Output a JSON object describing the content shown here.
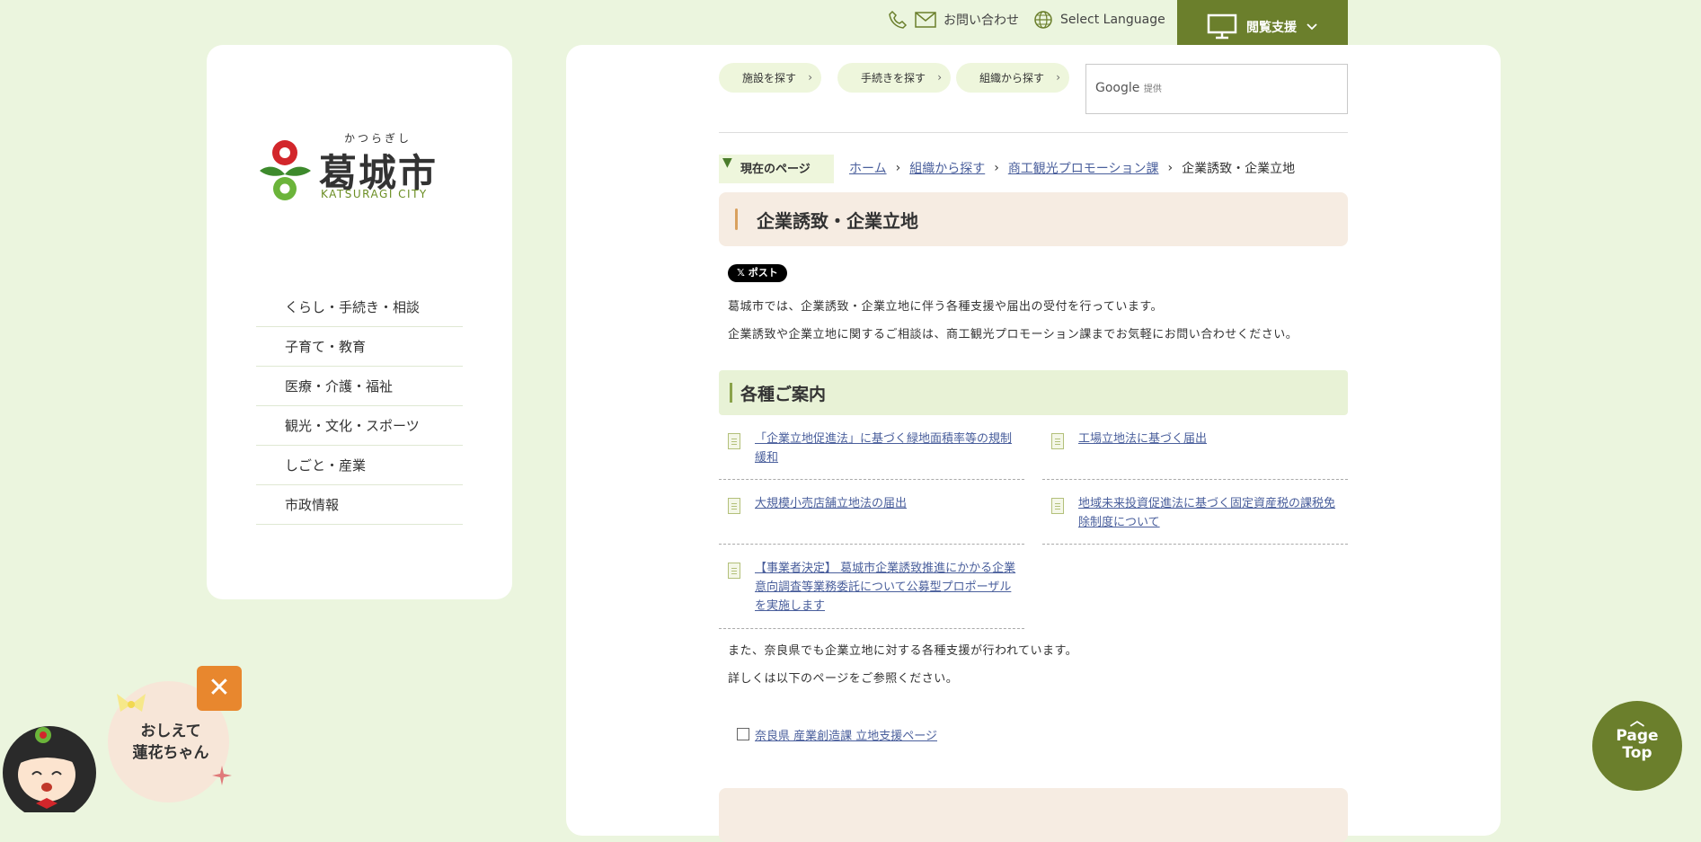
{
  "header": {
    "contact_label": "お問い合わせ",
    "language_label": "Select Language",
    "accessibility_label": "閲覧支援"
  },
  "logo": {
    "kana": "かつらぎし",
    "name": "葛城市",
    "english": "KATSURAGI CITY"
  },
  "sidebar": {
    "items": [
      {
        "label": "くらし・手続き・相談"
      },
      {
        "label": "子育て・教育"
      },
      {
        "label": "医療・介護・福祉"
      },
      {
        "label": "観光・文化・スポーツ"
      },
      {
        "label": "しごと・産業"
      },
      {
        "label": "市政情報"
      }
    ]
  },
  "quick_links": [
    {
      "label": "施設を探す"
    },
    {
      "label": "手続きを探す"
    },
    {
      "label": "組織から探す"
    }
  ],
  "search": {
    "brand": "Google",
    "provided": "提供"
  },
  "breadcrumb": {
    "label": "現在のページ",
    "items": [
      "ホーム",
      "組織から探す",
      "商工観光プロモーション課",
      "企業誘致・企業立地"
    ]
  },
  "page": {
    "title": "企業誘致・企業立地",
    "post_label": "ポスト",
    "intro": [
      "葛城市では、企業誘致・企業立地に伴う各種支援や届出の受付を行っています。",
      "企業誘致や企業立地に関するご相談は、商工観光プロモーション課までお気軽にお問い合わせください。"
    ],
    "section_title": "各種ご案内",
    "links": [
      {
        "label": "「企業立地促進法」に基づく緑地面積率等の規制緩和"
      },
      {
        "label": "工場立地法に基づく届出"
      },
      {
        "label": "大規模小売店舗立地法の届出"
      },
      {
        "label": "地域未来投資促進法に基づく固定資産税の課税免除制度について"
      },
      {
        "label": "【事業者決定】 葛城市企業誘致推進にかかる企業意向調査等業務委託について公募型プロポーザルを実施します"
      }
    ],
    "outro": [
      "また、奈良県でも企業立地に対する各種支援が行われています。",
      "詳しくは以下のページをご参照ください。"
    ],
    "external_link": "奈良県 産業創造課 立地支援ページ"
  },
  "page_top": {
    "line1": "Page",
    "line2": "Top"
  },
  "mascot": {
    "line1": "おしえて",
    "line2": "蓮花ちゃん",
    "close": "✕"
  },
  "colors": {
    "background": "#ebf5de",
    "accent_green": "#6b7f2c",
    "link": "#4a5f9c",
    "title_bg": "#f6ece2",
    "mascot_close": "#e8872e"
  }
}
